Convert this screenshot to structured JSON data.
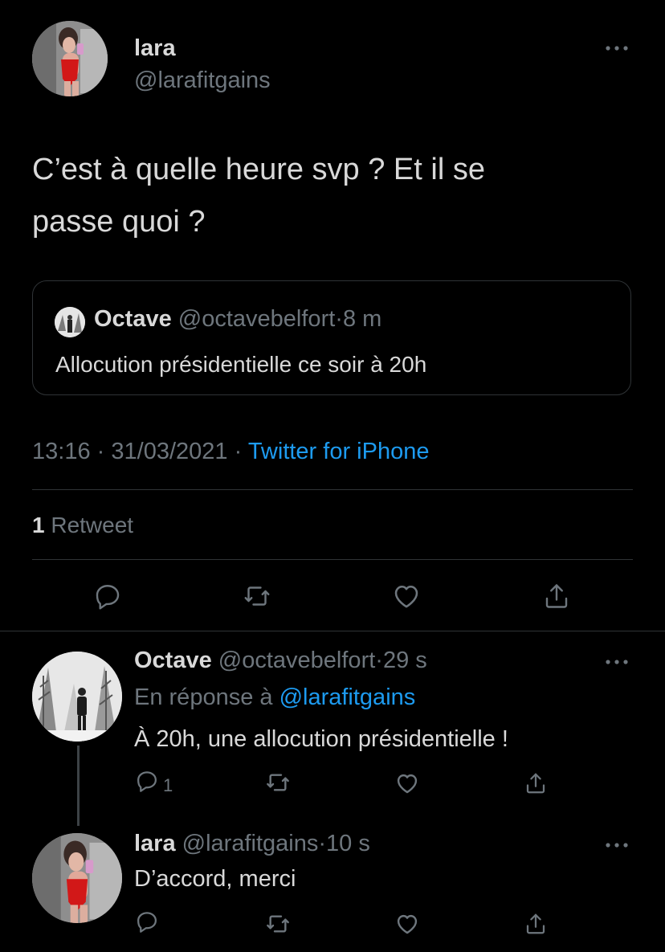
{
  "main_tweet": {
    "author_name": "lara",
    "author_handle": "@larafitgains",
    "text_line1": "C’est à quelle heure svp ? Et il se",
    "text_line2": "passe quoi ?",
    "quoted": {
      "author_name": "Octave",
      "author_handle": "@octavebelfort",
      "separator": "·",
      "time": "8 m",
      "text": "Allocution présidentielle ce soir à 20h"
    },
    "meta": {
      "time": "13:16",
      "sep1": "·",
      "date": "31/03/2021",
      "sep2": "·",
      "source": "Twitter for iPhone"
    },
    "stats": {
      "retweet_count": "1",
      "retweet_label": "Retweet"
    }
  },
  "reply1": {
    "author_name": "Octave",
    "author_handle": "@octavebelfort",
    "separator": "·",
    "time": "29 s",
    "replying_prefix": "En réponse à",
    "replying_to": "@larafitgains",
    "text": "À 20h, une allocution présidentielle !",
    "reply_count": "1"
  },
  "reply2": {
    "author_name": "lara",
    "author_handle": "@larafitgains",
    "separator": "·",
    "time": "10 s",
    "text": "D’accord, merci"
  },
  "colors": {
    "background": "#000000",
    "text": "#d9d9d9",
    "secondary": "#6e767d",
    "link": "#1d9bf0",
    "divider": "#2f3336"
  },
  "icons": [
    "more-icon",
    "reply-icon",
    "retweet-icon",
    "like-icon",
    "share-icon"
  ]
}
